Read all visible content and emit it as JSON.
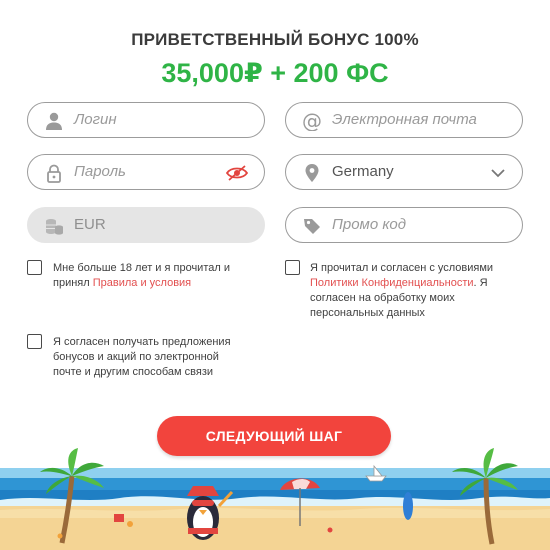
{
  "header": {
    "title": "ПРИВЕТСТВЕННЫЙ БОНУС 100%",
    "bonus": "35,000₽ + 200 ФС"
  },
  "form": {
    "login_placeholder": "Логин",
    "email_placeholder": "Электронная почта",
    "password_placeholder": "Пароль",
    "country_value": "Germany",
    "currency_value": "EUR",
    "promo_placeholder": "Промо код"
  },
  "consents": {
    "age_text_1": "Мне больше 18 лет и я прочитал и",
    "age_text_2": "принял ",
    "age_link": "Правила и условия",
    "privacy_text_1": "Я прочитал и согласен с условиями",
    "privacy_link": "Политики Конфиденциальности",
    "privacy_text_2": ". Я",
    "privacy_text_3": "согласен на обработку моих",
    "privacy_text_4": "персональных данных",
    "marketing_text_1": "Я согласен получать предложения",
    "marketing_text_2": "бонусов и акций по электронной",
    "marketing_text_3": "почте и другим способам связи"
  },
  "actions": {
    "next_label": "СЛЕДУЮЩИЙ ШАГ"
  },
  "colors": {
    "bonus_green": "#2fb446",
    "button_red": "#f2443d",
    "link_red": "#e24f4f"
  }
}
